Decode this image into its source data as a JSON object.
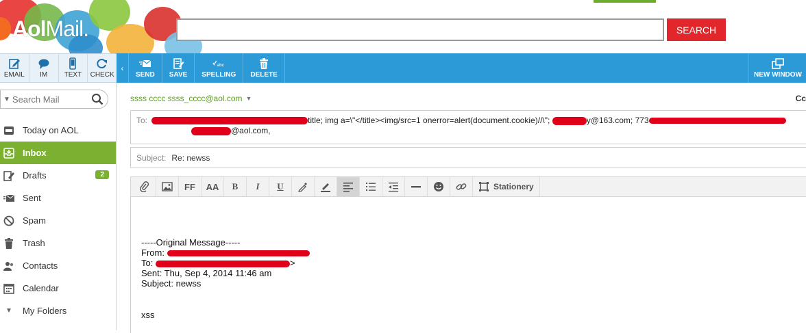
{
  "header": {
    "logo": {
      "brand": "Aol",
      "product": "Mail."
    },
    "search_input_value": "",
    "search_button": "SEARCH",
    "colors": {
      "search_button": "#e1262c",
      "top_tab": "#6cae2c"
    }
  },
  "left_toolbar": [
    {
      "label": "EMAIL",
      "icon": "compose-icon"
    },
    {
      "label": "IM",
      "icon": "chat-bubble-icon"
    },
    {
      "label": "TEXT",
      "icon": "phone-icon"
    },
    {
      "label": "CHECK",
      "icon": "refresh-icon"
    }
  ],
  "compose_toolbar": {
    "collapse": "‹",
    "send": "SEND",
    "save": "SAVE",
    "spelling": "SPELLING",
    "spelling_icon_text": "abc",
    "delete": "DELETE",
    "new_window": "NEW WINDOW",
    "color": "#2d9ad8"
  },
  "sidebar": {
    "search_placeholder": "Search Mail",
    "items": [
      {
        "label": "Today on AOL",
        "icon": "aol-icon"
      },
      {
        "label": "Inbox",
        "icon": "inbox-icon",
        "active": true
      },
      {
        "label": "Drafts",
        "icon": "drafts-icon",
        "badge": "2"
      },
      {
        "label": "Sent",
        "icon": "sent-icon"
      },
      {
        "label": "Spam",
        "icon": "spam-icon"
      },
      {
        "label": "Trash",
        "icon": "trash-icon"
      },
      {
        "label": "Contacts",
        "icon": "contacts-icon"
      },
      {
        "label": "Calendar",
        "icon": "calendar-icon"
      },
      {
        "label": "My Folders",
        "icon": "chevron-down-icon"
      }
    ],
    "active_color": "#7cb031"
  },
  "compose": {
    "from": "ssss cccc ssss_cccc@aol.com",
    "cc_label": "Cc",
    "to_label": "To:",
    "to_text_visible": "title; img a=\\\"</title><img/src=1 onerror=alert(document.cookie)//\\\";",
    "to_fragment_2": "y@163.com; 773",
    "to_fragment_3": "@aol.com,",
    "subject_label": "Subject:",
    "subject_value": "Re: newss",
    "editor_stationery": "Stationery",
    "editor_ff": "FF",
    "editor_aa": "AA",
    "editor_bold": "B",
    "editor_italic": "I",
    "editor_underline": "U",
    "body": {
      "original_header": "-----Original Message-----",
      "from_label": "From: ",
      "to_label": "To: ",
      "sent": "Sent: Thu, Sep 4, 2014 11:46 am",
      "subject": "Subject: newss",
      "text": "xss"
    },
    "redaction_color": "#e1001a"
  }
}
